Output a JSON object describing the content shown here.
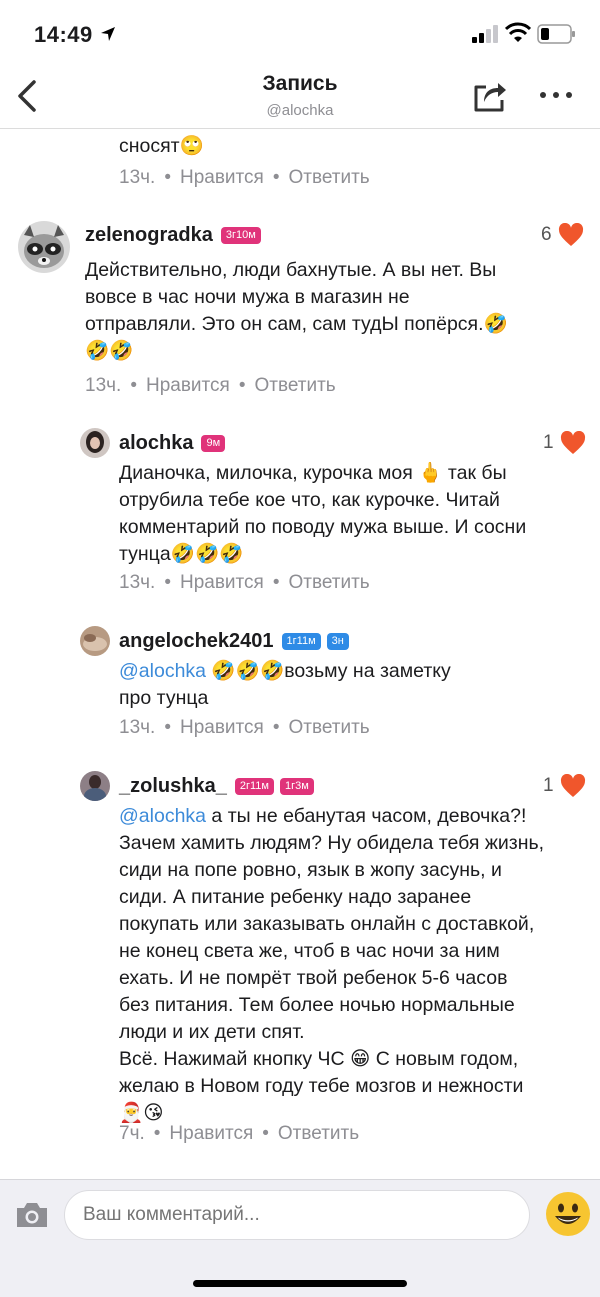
{
  "status_bar": {
    "time": "14:49"
  },
  "nav": {
    "title": "Запись",
    "subtitle": "@alochka"
  },
  "comments": [
    {
      "text": "сносят🙄",
      "time": "13ч.",
      "like_label": "Нравится",
      "reply_label": "Ответить"
    },
    {
      "username": "zelenogradka",
      "badges": [
        "3г10м"
      ],
      "likes": "6",
      "text": "Действительно, люди бахнутые. А вы нет. Вы\nвовсе в час ночи мужа в магазин не\nотправляли. Это он сам, сам тудЫ попёрся.🤣\n🤣🤣",
      "time": "13ч.",
      "like_label": "Нравится",
      "reply_label": "Ответить"
    },
    {
      "username": "alochka",
      "badges": [
        "9м"
      ],
      "likes": "1",
      "text": "Дианочка, милочка, курочка моя 🖕 так бы\nотрубила тебе кое что, как курочке. Читай\nкомментарий по поводу мужа выше. И сосни\nтунца🤣🤣🤣",
      "time": "13ч.",
      "like_label": "Нравится",
      "reply_label": "Ответить"
    },
    {
      "username": "angelochek2401",
      "badges": [
        "1г11м",
        "3н"
      ],
      "mention": "@alochka",
      "text": " 🤣🤣🤣возьму на заметку\nпро тунца",
      "time": "13ч.",
      "like_label": "Нравится",
      "reply_label": "Ответить"
    },
    {
      "username": "_zolushka_",
      "badges": [
        "2г11м",
        "1г3м"
      ],
      "likes": "1",
      "mention": "@alochka",
      "text": " а ты не ебанутая часом, девочка?!\nЗачем хамить людям? Ну обидела тебя жизнь,\nсиди на попе ровно, язык в жопу засунь, и\nсиди. А питание ребенку надо заранее\nпокупать или заказывать онлайн с доставкой,\nне конец света же, чтоб в час ночи за ним\nехать. И не помрёт твой ребенок 5-6 часов\nбез питания. Тем более ночью нормальные\nлюди и их дети спят.\nВсё. Нажимай кнопку ЧС 😁 С новым годом,\nжелаю в Новом году тебе мозгов и нежности\n🎅😘",
      "time": "7ч.",
      "like_label": "Нравится",
      "reply_label": "Ответить"
    }
  ],
  "composer": {
    "placeholder": "Ваш комментарий..."
  },
  "colors": {
    "accent": "#3d8bd9",
    "heart": "#f0562c",
    "badge_pink": "#e0337a",
    "badge_blue": "#2e8be6"
  },
  "icons": [
    "location-arrow-icon",
    "signal-icon",
    "wifi-icon",
    "battery-icon",
    "back-chevron-icon",
    "share-icon",
    "more-dots-icon",
    "heart-icon",
    "camera-icon",
    "smiley-emoji-icon"
  ]
}
